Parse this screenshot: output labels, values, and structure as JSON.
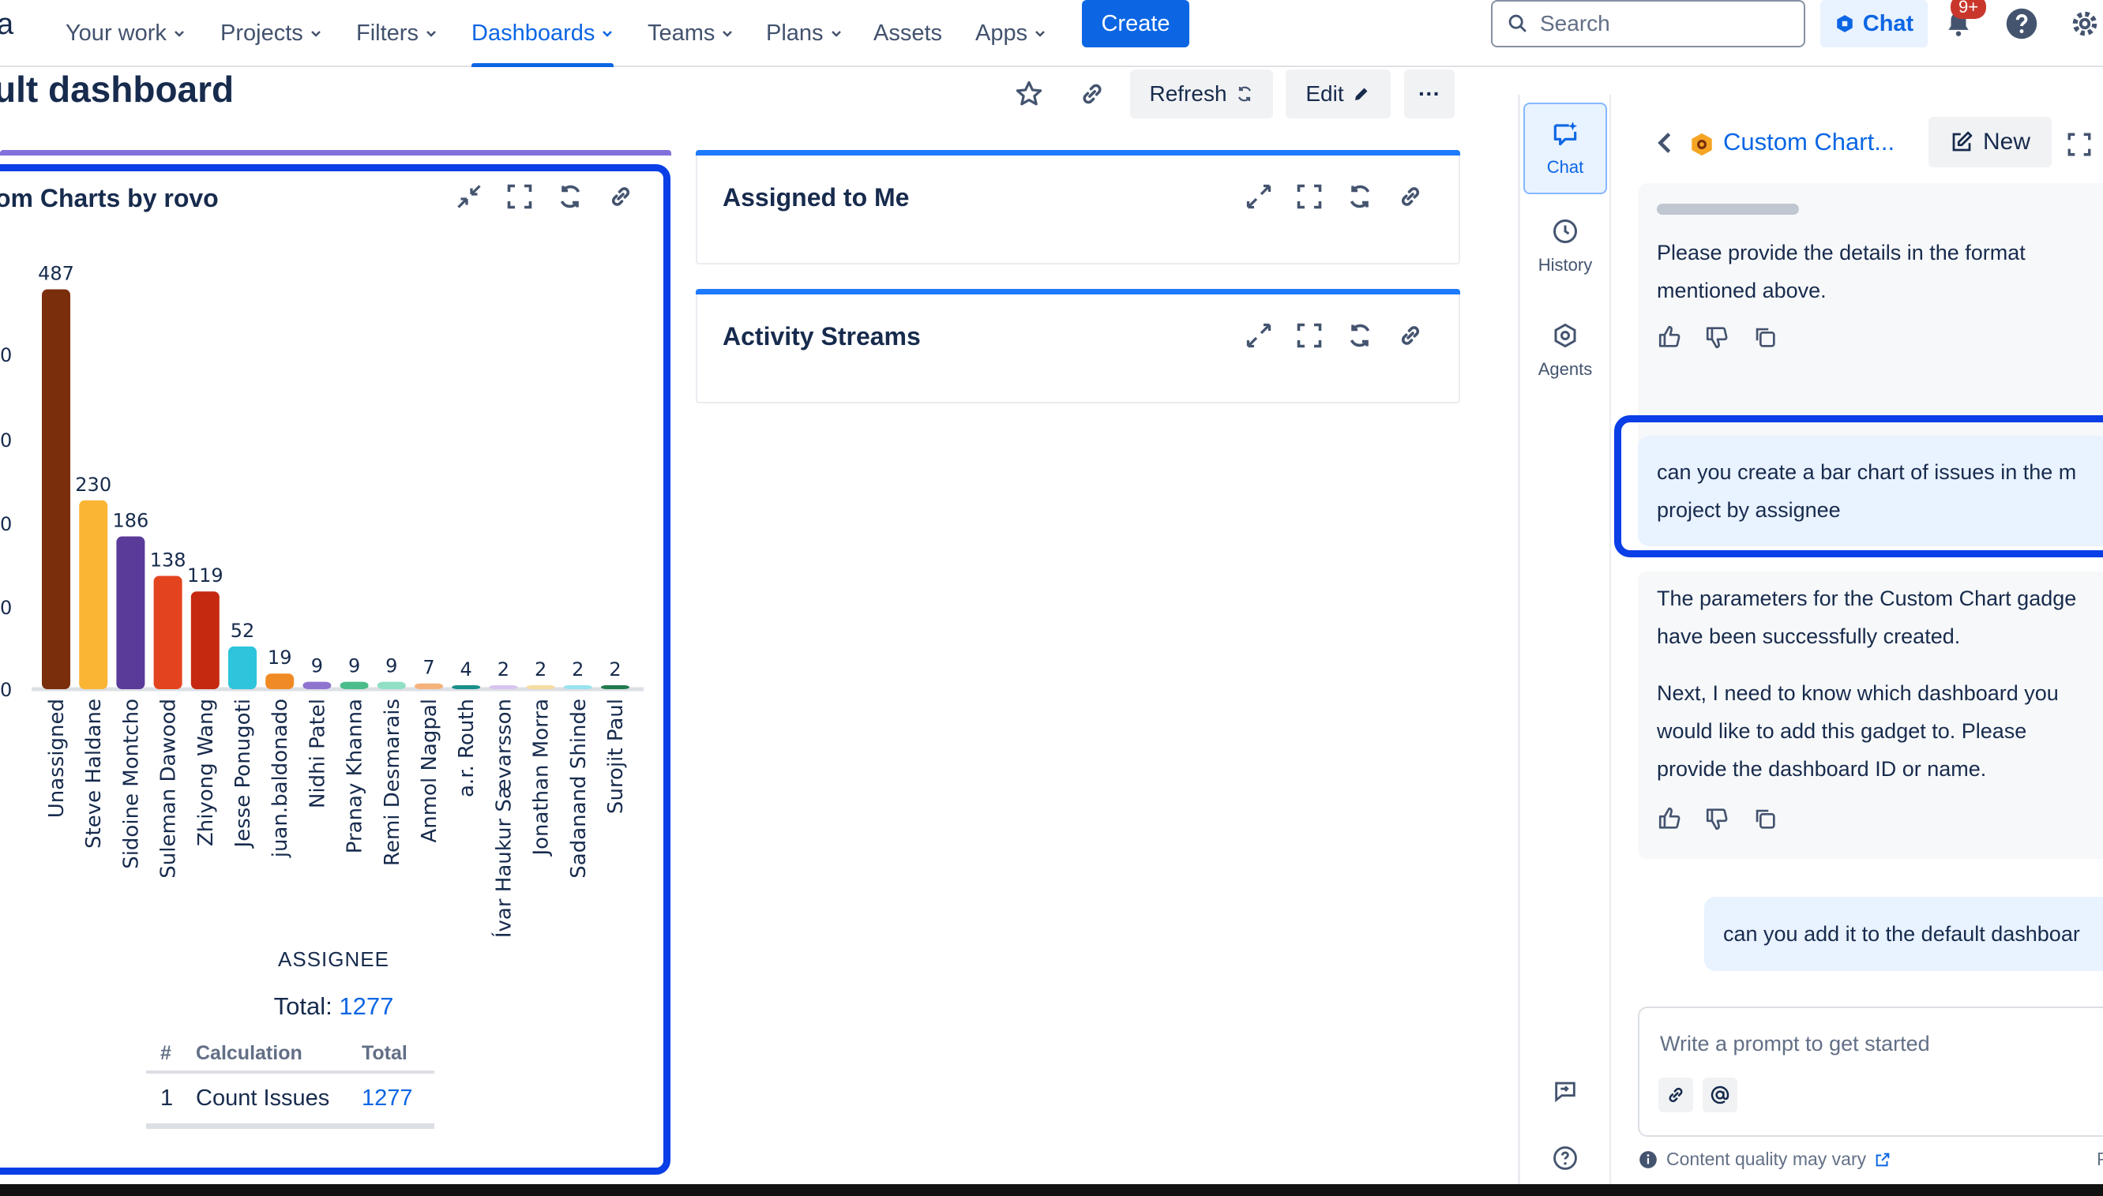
{
  "nav": {
    "logo_fragment": "a",
    "items": [
      "Your work",
      "Projects",
      "Filters",
      "Dashboards",
      "Teams",
      "Plans",
      "Assets",
      "Apps"
    ],
    "create_label": "Create",
    "search_placeholder": "Search",
    "chat_label": "Chat",
    "notification_badge": "9+"
  },
  "dashboard": {
    "title": "ult dashboard",
    "refresh_label": "Refresh",
    "edit_label": "Edit",
    "more_label": "···"
  },
  "gadgets": {
    "chart_title": "om Charts by rovo",
    "assigned_title": "Assigned to Me",
    "activity_title": "Activity Streams",
    "axis_title": "ASSIGNEE",
    "total_label": "Total:",
    "total_value": "1277",
    "table_headers": [
      "#",
      "Calculation",
      "Total"
    ],
    "table_row": [
      "1",
      "Count Issues",
      "1277"
    ],
    "y_tick_fragments": [
      "0",
      "0",
      "0",
      "0",
      "0"
    ]
  },
  "chart_data": {
    "type": "bar",
    "categories": [
      "Unassigned",
      "Steve Haldane",
      "Sidoine Montcho",
      "Suleman Dawood",
      "Zhiyong Wang",
      "Jesse Ponugoti",
      "juan.baldonado",
      "Nidhi Patel",
      "Pranay Khanna",
      "Remi Desmarais",
      "Anmol Nagpal",
      "a.r. Routh",
      "Ívar Haukur Sævarsson",
      "Jonathan Morra",
      "Sadanand Shinde",
      "Surojit Paul"
    ],
    "values": [
      487,
      230,
      186,
      138,
      119,
      52,
      19,
      9,
      9,
      9,
      7,
      4,
      2,
      2,
      2,
      2
    ],
    "colors": [
      "#7a2e0b",
      "#fbb534",
      "#5b3b9a",
      "#e3441f",
      "#c5290f",
      "#2ec4dc",
      "#f08a24",
      "#8f74cf",
      "#4bbd8a",
      "#8fe0c5",
      "#f5b27a",
      "#178f8a",
      "#d8c4f0",
      "#f7dca0",
      "#98e3ef",
      "#1f7a4e"
    ],
    "xlabel": "ASSIGNEE",
    "ylim": [
      0,
      500
    ]
  },
  "side_nav": {
    "items": [
      "Chat",
      "History",
      "Agents"
    ]
  },
  "chat": {
    "title": "Custom Chart...",
    "new_label": "New",
    "msg1": "Please provide the details in the format mentioned above.",
    "user1_line1": "can you create a bar chart of issues in the m",
    "user1_line2": "project by assignee",
    "bot2_line1": "The parameters for the Custom Chart gadge",
    "bot2_line2": "have been successfully created.",
    "bot2_para2": "Next, I need to know which dashboard you would like to add this gadget to. Please provide the dashboard ID or name.",
    "user2": "can you add it to the default dashboar",
    "prompt_placeholder": "Write a prompt to get started",
    "quality_note": "Content quality may vary",
    "footer_fragment": "P"
  }
}
